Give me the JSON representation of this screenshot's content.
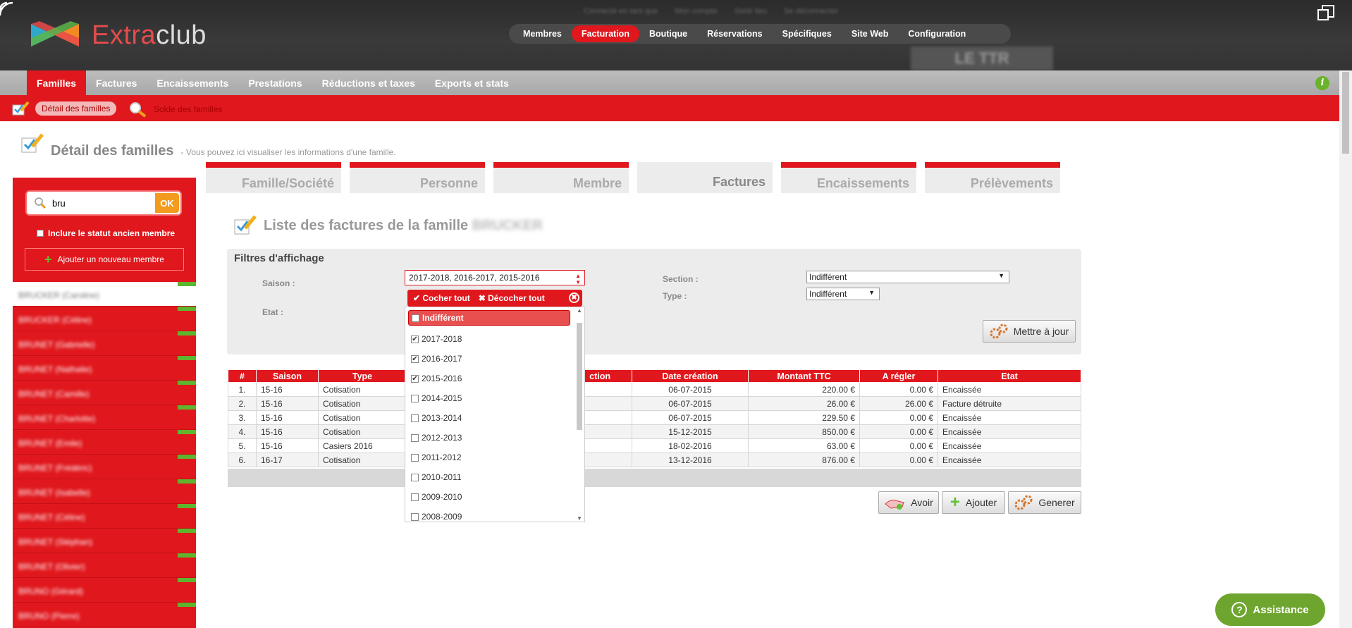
{
  "header": {
    "logo_prefix": "Extra",
    "logo_suffix": "club",
    "user_info": [
      "Connecté en tant que",
      "Mon compte",
      "Sortir lieu",
      "Se déconnecter"
    ],
    "club_badge": "LE TTR",
    "main_nav": [
      "Membres",
      "Facturation",
      "Boutique",
      "Réservations",
      "Spécifiques",
      "Site Web",
      "Configuration"
    ],
    "main_nav_active": "Facturation"
  },
  "subnav": {
    "items": [
      "Familles",
      "Factures",
      "Encaissements",
      "Prestations",
      "Réductions et taxes",
      "Exports et stats"
    ],
    "active": "Familles",
    "info_glyph": "i"
  },
  "redbar": {
    "detail": "Détail des familles",
    "solde": "Solde des familles"
  },
  "page": {
    "title": "Détail des familles",
    "subtitle": "- Vous pouvez ici visualiser les informations d'une famille."
  },
  "sidebar": {
    "search_value": "bru",
    "ok_label": "OK",
    "include_old_label": "Inclure le statut ancien membre",
    "add_member_label": "Ajouter un nouveau membre",
    "members": [
      "BRUCKER (Caroline)",
      "BRUCKER (Céline)",
      "BRUNET (Gabrielle)",
      "BRUNET (Nathalie)",
      "BRUNET (Camille)",
      "BRUNET (Charlotte)",
      "BRUNET (Emile)",
      "BRUNET (Frédéric)",
      "BRUNET (Isabelle)",
      "BRUNET (Céline)",
      "BRUNET (Stéphan)",
      "BRUNET (Olivier)",
      "BRUNO (Gérard)",
      "BRUNO (Pierre)"
    ]
  },
  "tabs": [
    "Famille/Société",
    "Personne",
    "Membre",
    "Factures",
    "Encaissements",
    "Prélèvements"
  ],
  "active_tab": "Factures",
  "list": {
    "title": "Liste des factures de la famille",
    "family_name": "BRUCKER"
  },
  "filters": {
    "heading": "Filtres d'affichage",
    "saison_label": "Saison :",
    "saison_value": "2017-2018, 2016-2017, 2015-2016",
    "etat_label": "Etat :",
    "section_label": "Section :",
    "section_value": "Indifférent",
    "type_label": "Type :",
    "type_value": "Indifférent",
    "update_label": "Mettre à jour"
  },
  "dropdown": {
    "check_all": "Cocher tout",
    "uncheck_all": "Décocher tout",
    "options": [
      {
        "label": "Indifférent",
        "checked": false
      },
      {
        "label": "2017-2018",
        "checked": true
      },
      {
        "label": "2016-2017",
        "checked": true
      },
      {
        "label": "2015-2016",
        "checked": true
      },
      {
        "label": "2014-2015",
        "checked": false
      },
      {
        "label": "2013-2014",
        "checked": false
      },
      {
        "label": "2012-2013",
        "checked": false
      },
      {
        "label": "2011-2012",
        "checked": false
      },
      {
        "label": "2010-2011",
        "checked": false
      },
      {
        "label": "2009-2010",
        "checked": false
      },
      {
        "label": "2008-2009",
        "checked": false
      }
    ]
  },
  "table": {
    "headers": [
      "#",
      "Saison",
      "Type",
      "ction",
      "Date création",
      "Montant TTC",
      "A régler",
      "Etat"
    ],
    "rows": [
      [
        "1.",
        "15-16",
        "Cotisation",
        "",
        "06-07-2015",
        "220.00 €",
        "0.00 €",
        "Encaissée"
      ],
      [
        "2.",
        "15-16",
        "Cotisation",
        "",
        "06-07-2015",
        "26.00 €",
        "26.00 €",
        "Facture détruite"
      ],
      [
        "3.",
        "15-16",
        "Cotisation",
        "",
        "06-07-2015",
        "229.50 €",
        "0.00 €",
        "Encaissée"
      ],
      [
        "4.",
        "15-16",
        "Cotisation",
        "",
        "15-12-2015",
        "850.00 €",
        "0.00 €",
        "Encaissée"
      ],
      [
        "5.",
        "15-16",
        "Casiers 2016",
        "",
        "18-02-2016",
        "63.00 €",
        "0.00 €",
        "Encaissée"
      ],
      [
        "6.",
        "16-17",
        "Cotisation",
        "",
        "13-12-2016",
        "876.00 €",
        "0.00 €",
        "Encaissée"
      ]
    ]
  },
  "actions": {
    "avoir": "Avoir",
    "ajouter": "Ajouter",
    "generer": "Generer"
  },
  "assistance": {
    "label": "Assistance",
    "glyph": "?"
  },
  "colors": {
    "brand_red": "#e0181d",
    "accent_orange": "#f29b1e",
    "accent_green": "#6ea52f"
  }
}
